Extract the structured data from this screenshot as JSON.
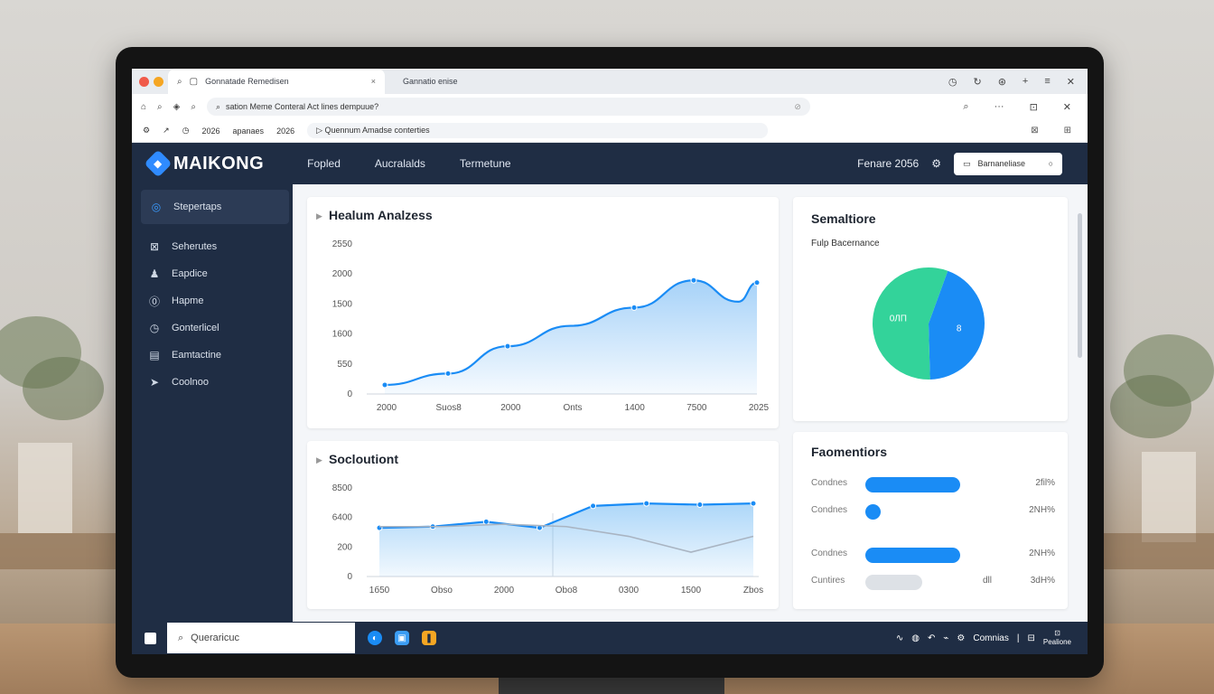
{
  "browser": {
    "tabs": [
      {
        "label": "Gonnatade Remedisen",
        "active": true
      },
      {
        "label": "Gannatio enise",
        "active": false
      }
    ],
    "address": "sation Meme Conteral Act lines dempuue?",
    "bookmarks": {
      "year_a": "2026",
      "label_a": "apanaes",
      "year_b": "2026",
      "page": "Quennum Amadse conterties"
    }
  },
  "header": {
    "logo": "MAIKONG",
    "nav": [
      "Fopled",
      "Aucralalds",
      "Termetune"
    ],
    "date": "Fenare 2056",
    "search_label": "Barnaneliase"
  },
  "sidebar": {
    "items": [
      {
        "label": "Stepertaps",
        "icon": "target-icon",
        "active": true
      },
      {
        "label": "Seherutes",
        "icon": "edit-icon",
        "active": false
      },
      {
        "label": "Eapdice",
        "icon": "user-icon",
        "active": false
      },
      {
        "label": "Hapme",
        "icon": "home-icon",
        "active": false
      },
      {
        "label": "Gonterlicel",
        "icon": "clock-icon",
        "active": false
      },
      {
        "label": "Eamtactine",
        "icon": "briefcase-icon",
        "active": false
      },
      {
        "label": "Coolnoo",
        "icon": "arrow-icon",
        "active": false
      }
    ]
  },
  "cards": {
    "chart1_title": "Healum Analzess",
    "chart2_title": "Socloutiont",
    "pie_title": "Semaltiore",
    "pie_subtitle": "Fulp Bacernance",
    "frag_title": "Faomentiors",
    "frag_rows": [
      {
        "label": "Condnes",
        "value": "2fil%",
        "extra": "",
        "color": "#1a8cf5",
        "fill": 0.55
      },
      {
        "label": "Condnes",
        "value": "2NH%",
        "extra": "",
        "color": "#1a8cf5",
        "fill": 0.09
      },
      {
        "label": "Condnes",
        "value": "2NH%",
        "extra": "",
        "color": "#1a8cf5",
        "fill": 0.55
      },
      {
        "label": "Cuntires",
        "value": "3dH%",
        "extra": "dll",
        "color": "#dde1e6",
        "fill": 0.33
      }
    ]
  },
  "chart_data": [
    {
      "type": "area",
      "title": "Healum Analzess",
      "x_tick_labels": [
        "2000",
        "Suos8",
        "2000",
        "Onts",
        "1400",
        "7500",
        "2025"
      ],
      "y_tick_labels": [
        "0",
        "550",
        "1600",
        "1500",
        "2000",
        "2550"
      ],
      "series": [
        {
          "values": [
            200,
            450,
            1050,
            1500,
            1900,
            2500,
            2030,
            2450
          ],
          "x_positions": [
            0,
            0.17,
            0.33,
            0.5,
            0.67,
            0.83,
            0.95,
            1.0
          ]
        }
      ],
      "ylim": [
        0,
        3300
      ]
    },
    {
      "type": "area",
      "title": "Socloutiont",
      "x_tick_labels": [
        "1б50",
        "Obso",
        "2000",
        "Obo8",
        "0300",
        "1500",
        "Zbos"
      ],
      "y_tick_labels": [
        "0",
        "200",
        "6400",
        "8500"
      ],
      "series": [
        {
          "values": [
            4000,
            4100,
            4500,
            4000,
            5800,
            6000,
            5900,
            6000
          ]
        },
        {
          "values": [
            4100,
            4100,
            4300,
            4100,
            3300,
            2000,
            3300
          ]
        }
      ],
      "ylim": [
        0,
        8000
      ]
    },
    {
      "type": "pie",
      "title": "Semaltiore",
      "slices": [
        {
          "label": "8",
          "value": 44,
          "color": "#1a8cf5"
        },
        {
          "label": "0ЛП",
          "value": 56,
          "color": "#33d39a"
        }
      ]
    }
  ],
  "taskbar": {
    "search": "Queraricuc",
    "tray_label": "Comnias",
    "clock_label": "Pealione"
  }
}
